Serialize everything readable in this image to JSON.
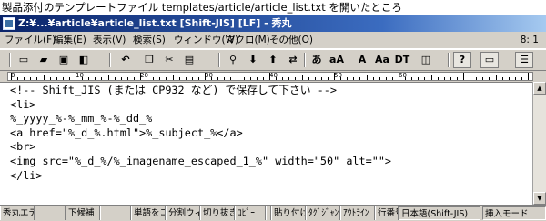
{
  "caption": "製品添付のテンプレートファイル templates/article/article_list.txt を開いたところ",
  "window": {
    "title": "Z:¥...¥article¥article_list.txt  [Shift-JIS] [LF] - 秀丸"
  },
  "menubar": {
    "items": [
      "ファイル(F)",
      "編集(E)",
      "表示(V)",
      "検索(S)",
      "ウィンドウ(W)",
      "マクロ(M)",
      "その他(O)"
    ],
    "cursor_position": "8: 1"
  },
  "toolbar": {
    "buttons": [
      {
        "icon": "new-file-icon",
        "glyph": "▭"
      },
      {
        "icon": "open-folder-icon",
        "glyph": "▰"
      },
      {
        "icon": "save-icon",
        "glyph": "▣"
      },
      {
        "icon": "save-as-icon",
        "glyph": "◧"
      },
      {
        "icon": "undo-icon",
        "glyph": "↶"
      },
      {
        "icon": "copy-icon",
        "glyph": "❐"
      },
      {
        "icon": "cut-icon",
        "glyph": "✂"
      },
      {
        "icon": "paste-icon",
        "glyph": "▤"
      },
      {
        "icon": "find-icon",
        "glyph": "⚲"
      },
      {
        "icon": "find-down-icon",
        "glyph": "⬇"
      },
      {
        "icon": "find-up-icon",
        "glyph": "⬆"
      },
      {
        "icon": "replace-icon",
        "glyph": "⇄"
      },
      {
        "icon": "case-a-icon",
        "glyph": "あ"
      },
      {
        "icon": "case-aa-icon",
        "glyph": "aA"
      },
      {
        "icon": "width-a-icon",
        "glyph": "A"
      },
      {
        "icon": "width-aa-icon",
        "glyph": "Aa"
      },
      {
        "icon": "grep-icon",
        "glyph": "DT"
      },
      {
        "icon": "compare-icon",
        "glyph": "◫"
      },
      {
        "icon": "help-icon",
        "glyph": "?"
      },
      {
        "icon": "window-icon",
        "glyph": "▭"
      },
      {
        "icon": "split-icon",
        "glyph": "☰"
      }
    ]
  },
  "ruler": {
    "labels": [
      "0",
      "10",
      "20",
      "30",
      "40",
      "50",
      "60"
    ]
  },
  "editor": {
    "lines": [
      "<!-- Shift_JIS (または CP932 など) で保存して下さい -->",
      "<li>",
      "%_yyyy_%-%_mm_%-%_dd_%",
      "<a href=\"%_d_%.html\">%_subject_%</a>",
      "<br>",
      "<img src=\"%_d_%/%_imagename_escaped_1_%\" width=\"50\" alt=\"\">",
      "</li>"
    ]
  },
  "funcbar": {
    "keys": [
      "秀丸エデ",
      "",
      "下候補",
      "",
      "単語をコ",
      "分割ウィ",
      "切り抜き",
      "ｺﾋﾟｰ",
      "",
      "貼り付け",
      "ﾀｸﾞｼﾞｬﾝ",
      "ｱｳﾄﾗｲﾝ",
      "行番号"
    ],
    "encoding": "日本語(Shift-JIS)",
    "mode": "挿入モード"
  }
}
